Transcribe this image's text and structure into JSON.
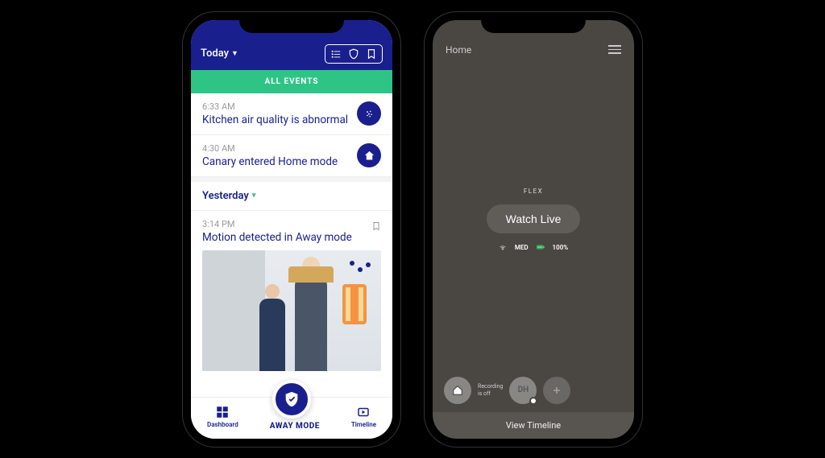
{
  "left": {
    "header": {
      "today_label": "Today",
      "all_events": "ALL EVENTS"
    },
    "events": {
      "today": [
        {
          "time": "6:33 AM",
          "title": "Kitchen air quality is abnormal",
          "icon": "air-quality"
        },
        {
          "time": "4:30 AM",
          "title": "Canary entered Home mode",
          "icon": "home"
        }
      ],
      "yesterday_label": "Yesterday",
      "yesterday": [
        {
          "time": "3:14 PM",
          "title": "Motion detected in Away mode"
        }
      ]
    },
    "nav": {
      "dashboard": "Dashboard",
      "away_mode": "AWAY MODE",
      "timeline": "Timeline"
    }
  },
  "right": {
    "header": {
      "title": "Home"
    },
    "camera": {
      "name": "FLEX",
      "watch_live": "Watch Live",
      "wifi_level": "MED",
      "battery": "100%"
    },
    "members": {
      "recording_status": "Recording\nis off",
      "initials": "DH"
    },
    "footer": {
      "view_timeline": "View Timeline"
    }
  }
}
